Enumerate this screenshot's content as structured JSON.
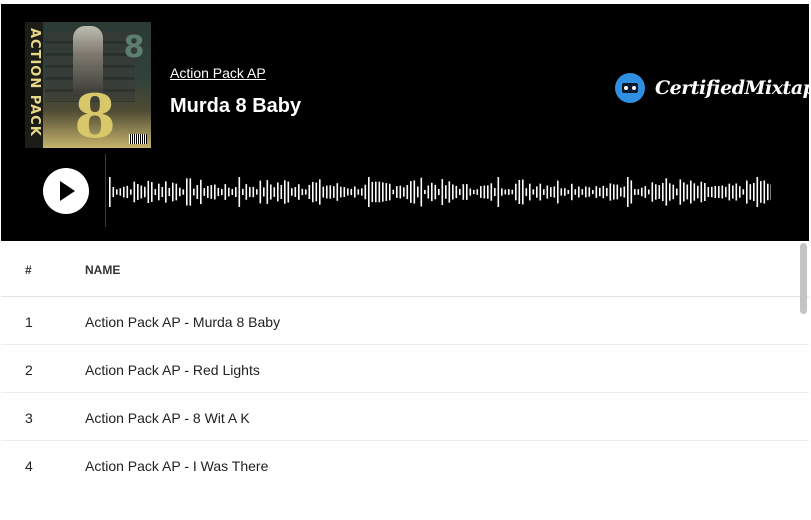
{
  "player": {
    "artist": "Action Pack AP",
    "track_title": "Murda 8 Baby",
    "cover_text": "ACTION PACK",
    "cover_number": "8",
    "brand_name": "CertifiedMixtapes",
    "play_icon": "play-icon",
    "brand_icon": "cassette-logo-icon",
    "colors": {
      "background": "#000000",
      "accent": "#2f8fe0",
      "text": "#ffffff"
    }
  },
  "table": {
    "headers": {
      "number": "#",
      "name": "NAME"
    },
    "rows": [
      {
        "number": "1",
        "name": "Action Pack AP - Murda 8 Baby"
      },
      {
        "number": "2",
        "name": "Action Pack AP - Red Lights"
      },
      {
        "number": "3",
        "name": "Action Pack AP - 8 Wit A K"
      },
      {
        "number": "4",
        "name": "Action Pack AP - I Was There"
      }
    ]
  }
}
